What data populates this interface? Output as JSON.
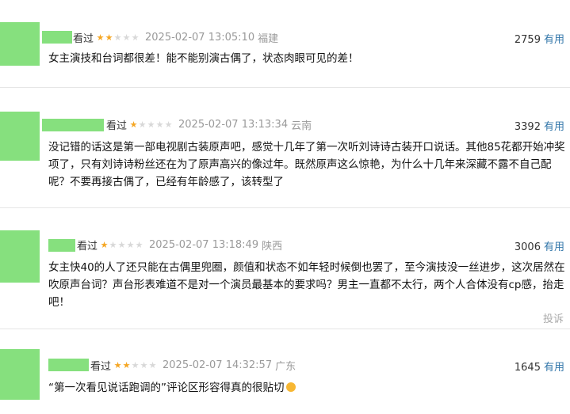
{
  "useful_label": "有用",
  "report_label": "投诉",
  "comments": [
    {
      "status": "看过",
      "rating": 2,
      "time": "2025-02-07 13:05:10",
      "location": "福建",
      "votes": "2759",
      "text": "女主演技和台词都很差！能不能别演古偶了，状态肉眼可见的差！"
    },
    {
      "status": "看过",
      "rating": 1,
      "time": "2025-02-07 13:13:34",
      "location": "云南",
      "votes": "3392",
      "text": "没记错的话这是第一部电视剧古装原声吧，感觉十几年了第一次听刘诗诗古装开口说话。其他85花都开始冲奖项了，只有刘诗诗粉丝还在为了原声高兴的像过年。既然原声这么惊艳，为什么十几年来深藏不露不自己配呢？不要再接古偶了，已经有年龄感了，该转型了"
    },
    {
      "status": "看过",
      "rating": 1,
      "time": "2025-02-07 13:18:49",
      "location": "陕西",
      "votes": "3006",
      "text": "女主快40的人了还只能在古偶里兜圈，颜值和状态不如年轻时候倒也罢了，至今演技没一丝进步，这次居然在吹原声台词？声台形表难道不是对一个演员最基本的要求吗？男主一直都不太行，两个人合体没有cp感，抬走吧！"
    },
    {
      "status": "看过",
      "rating": 2,
      "time": "2025-02-07 14:32:57",
      "location": "广东",
      "votes": "1645",
      "text": "“第一次看见说话跑调的”评论区形容得真的很贴切"
    }
  ],
  "colors": {
    "star": "#f5a623",
    "useful": "#3377aa",
    "avatar": "#86e07e"
  },
  "icons": {
    "star": "star-icon",
    "emoji": "laughing-emoji-icon"
  }
}
